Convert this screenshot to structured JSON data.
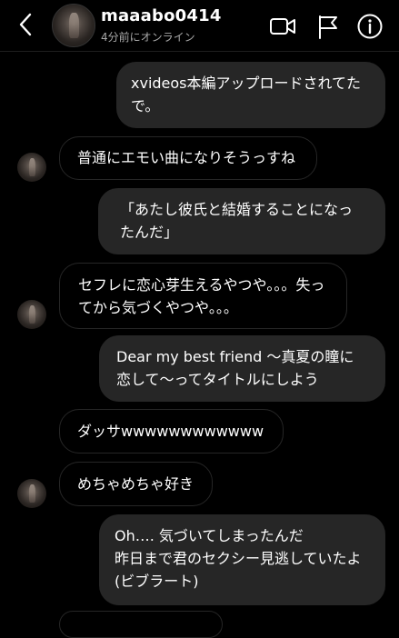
{
  "header": {
    "username": "maaabo0414",
    "status": "4分前にオンライン",
    "icons": [
      "back-chevron-icon",
      "video-call-icon",
      "flag-icon",
      "info-icon"
    ]
  },
  "messages": [
    {
      "side": "sent",
      "text": "xvideos本編アップロードされてたで。"
    },
    {
      "side": "received",
      "text": "普通にエモい曲になりそうっすね"
    },
    {
      "side": "sent",
      "text": "「あたし彼氏と結婚することになったんだ」"
    },
    {
      "side": "received",
      "text": "セフレに恋心芽生えるやつや。。。失ってから気づくやつや。。。"
    },
    {
      "side": "sent",
      "text": "Dear my best friend 〜真夏の瞳に恋して〜ってタイトルにしよう"
    },
    {
      "side": "received",
      "text": "ダッサwwwwwwwwwwww"
    },
    {
      "side": "received",
      "text": "めちゃめちゃ好き"
    },
    {
      "side": "sent",
      "text": "Oh…. 気づいてしまったんだ\n昨日まで君のセクシー見逃していたよ\n(ビブラート)"
    }
  ],
  "colors": {
    "background": "#000000",
    "sent_bubble": "#262626",
    "received_border": "#262626",
    "status_text": "#a8a8a8"
  }
}
